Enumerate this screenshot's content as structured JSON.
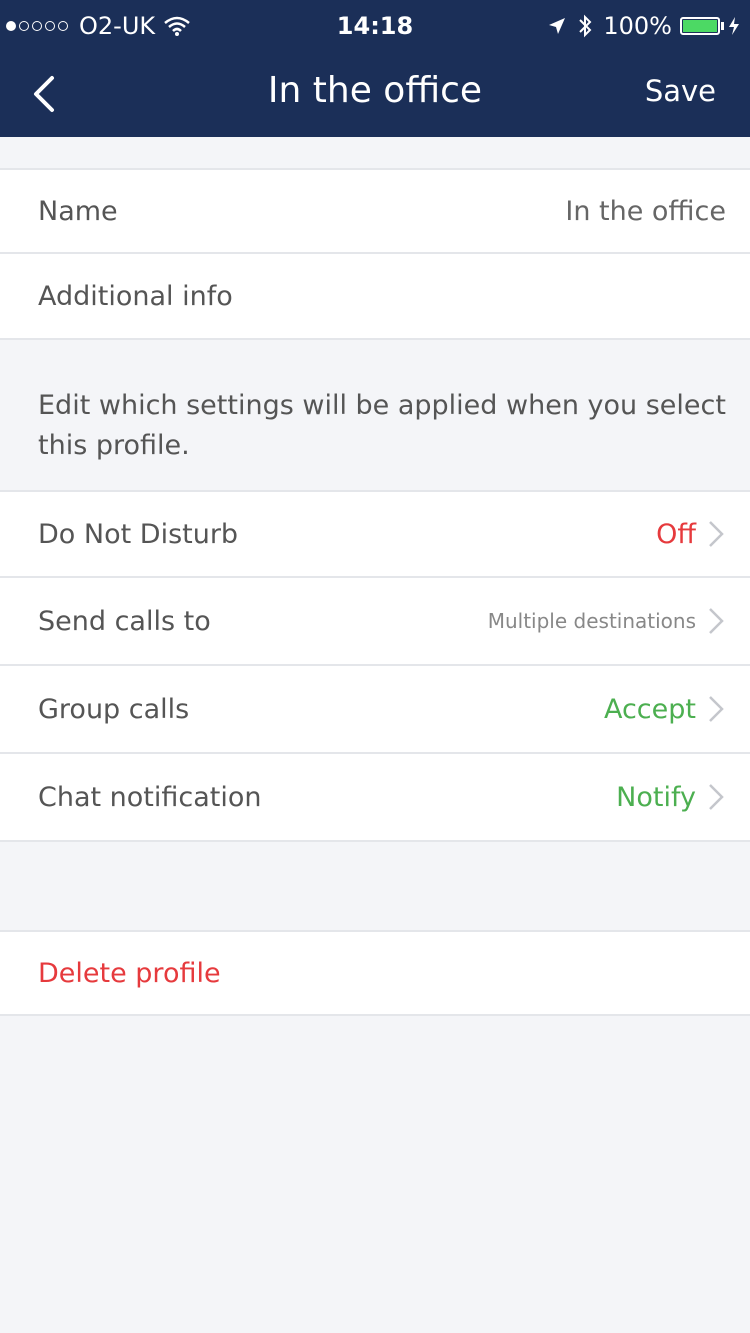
{
  "status_bar": {
    "signal": "●○○○○",
    "carrier": "O2-UK",
    "time": "14:18",
    "battery": "100%"
  },
  "nav": {
    "title": "In the office",
    "save_label": "Save"
  },
  "profile": {
    "name_label": "Name",
    "name_value": "In the office",
    "additional_info_label": "Additional info"
  },
  "description": "Edit which settings will be applied when you select this profile.",
  "settings": {
    "dnd_label": "Do Not Disturb",
    "dnd_value": "Off",
    "send_calls_label": "Send calls to",
    "send_calls_value": "Multiple destinations",
    "group_calls_label": "Group calls",
    "group_calls_value": "Accept",
    "chat_label": "Chat notification",
    "chat_value": "Notify"
  },
  "delete_label": "Delete profile",
  "colors": {
    "nav_bg": "#1b2f58",
    "danger": "#e63a3d",
    "success": "#4caf50"
  }
}
